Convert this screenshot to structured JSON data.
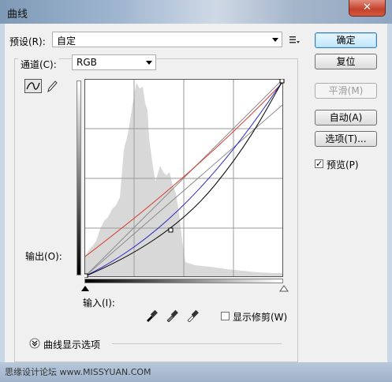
{
  "window": {
    "title": "曲线",
    "close_label": "✕"
  },
  "preset": {
    "label": "预设(R):",
    "value": "自定"
  },
  "channel": {
    "label": "通道(C):",
    "value": "RGB"
  },
  "buttons": {
    "ok": "确定",
    "reset": "复位",
    "smooth": "平滑(M)",
    "auto": "自动(A)",
    "options": "选项(T)...",
    "preview": "预览(P)"
  },
  "output_label": "输出(O):",
  "input_label": "输入(I):",
  "show_clipping_label": "显示修剪(W)",
  "curve_display_options_label": "曲线显示选项",
  "footer_text": "思缘设计论坛  www.MISSYUAN.COM",
  "colors": {
    "red_curve": "#d83a2a",
    "blue_curve": "#2828c8",
    "black_curve": "#000000"
  }
}
